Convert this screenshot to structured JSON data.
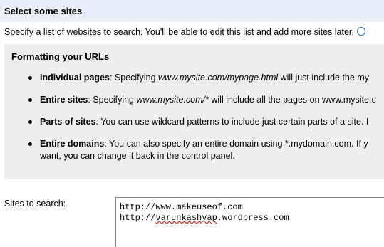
{
  "header": {
    "title": "Select some sites"
  },
  "intro": {
    "text": "Specify a list of websites to search. You'll be able to edit this list and add more sites later."
  },
  "info": {
    "title": "Formatting your URLs",
    "rules": [
      {
        "name": "Individual pages",
        "text": ": Specifying ",
        "example": "www.mysite.com/mypage.html",
        "rest": " will just include the my"
      },
      {
        "name": "Entire sites",
        "text": ": Specifying ",
        "example": "www.mysite.com/*",
        "rest": " will include all the pages on www.mysite.c"
      },
      {
        "name": "Parts of sites",
        "text": ": You can use wildcard patterns to include just certain parts of a site. I",
        "example": "",
        "rest": ""
      },
      {
        "name": "Entire domains",
        "text": ": You can also specify an entire domain using *.mydomain.com. If y",
        "example": "",
        "rest": "",
        "cont": "want, you can change it back in the control panel."
      }
    ]
  },
  "sites": {
    "label": "Sites to search:",
    "line1": "http://www.makeuseof.com",
    "line2_prefix": "http://",
    "line2_word": "varunkashyap",
    "line2_suffix": ".wordpress.com"
  }
}
